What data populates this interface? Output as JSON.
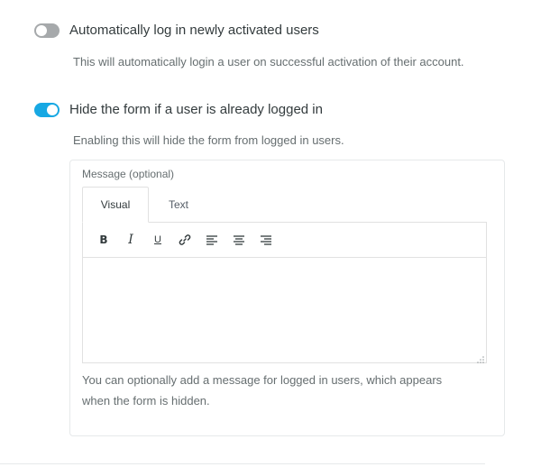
{
  "settings": [
    {
      "label": "Automatically log in newly activated users",
      "description": "This will automatically login a user on successful activation of their account.",
      "enabled": false
    },
    {
      "label": "Hide the form if a user is already logged in",
      "description": "Enabling this will hide the form from logged in users.",
      "enabled": true
    }
  ],
  "message_panel": {
    "label": "Message (optional)",
    "tabs": [
      "Visual",
      "Text"
    ],
    "active_tab": "Visual",
    "toolbar": {
      "bold": "B",
      "italic": "I",
      "underline": "U",
      "icons": [
        "bold-icon",
        "italic-icon",
        "underline-icon",
        "link-icon",
        "align-left-icon",
        "align-center-icon",
        "align-right-icon"
      ]
    },
    "editor_value": "",
    "help_text": "You can optionally add a message for logged in users, which appears when the form is hidden."
  },
  "colors": {
    "toggle_on": "#17a8e3",
    "toggle_off": "#a6a9ab",
    "text_primary": "#333b3d",
    "text_secondary": "#666e70",
    "border": "#e6e9ea"
  }
}
